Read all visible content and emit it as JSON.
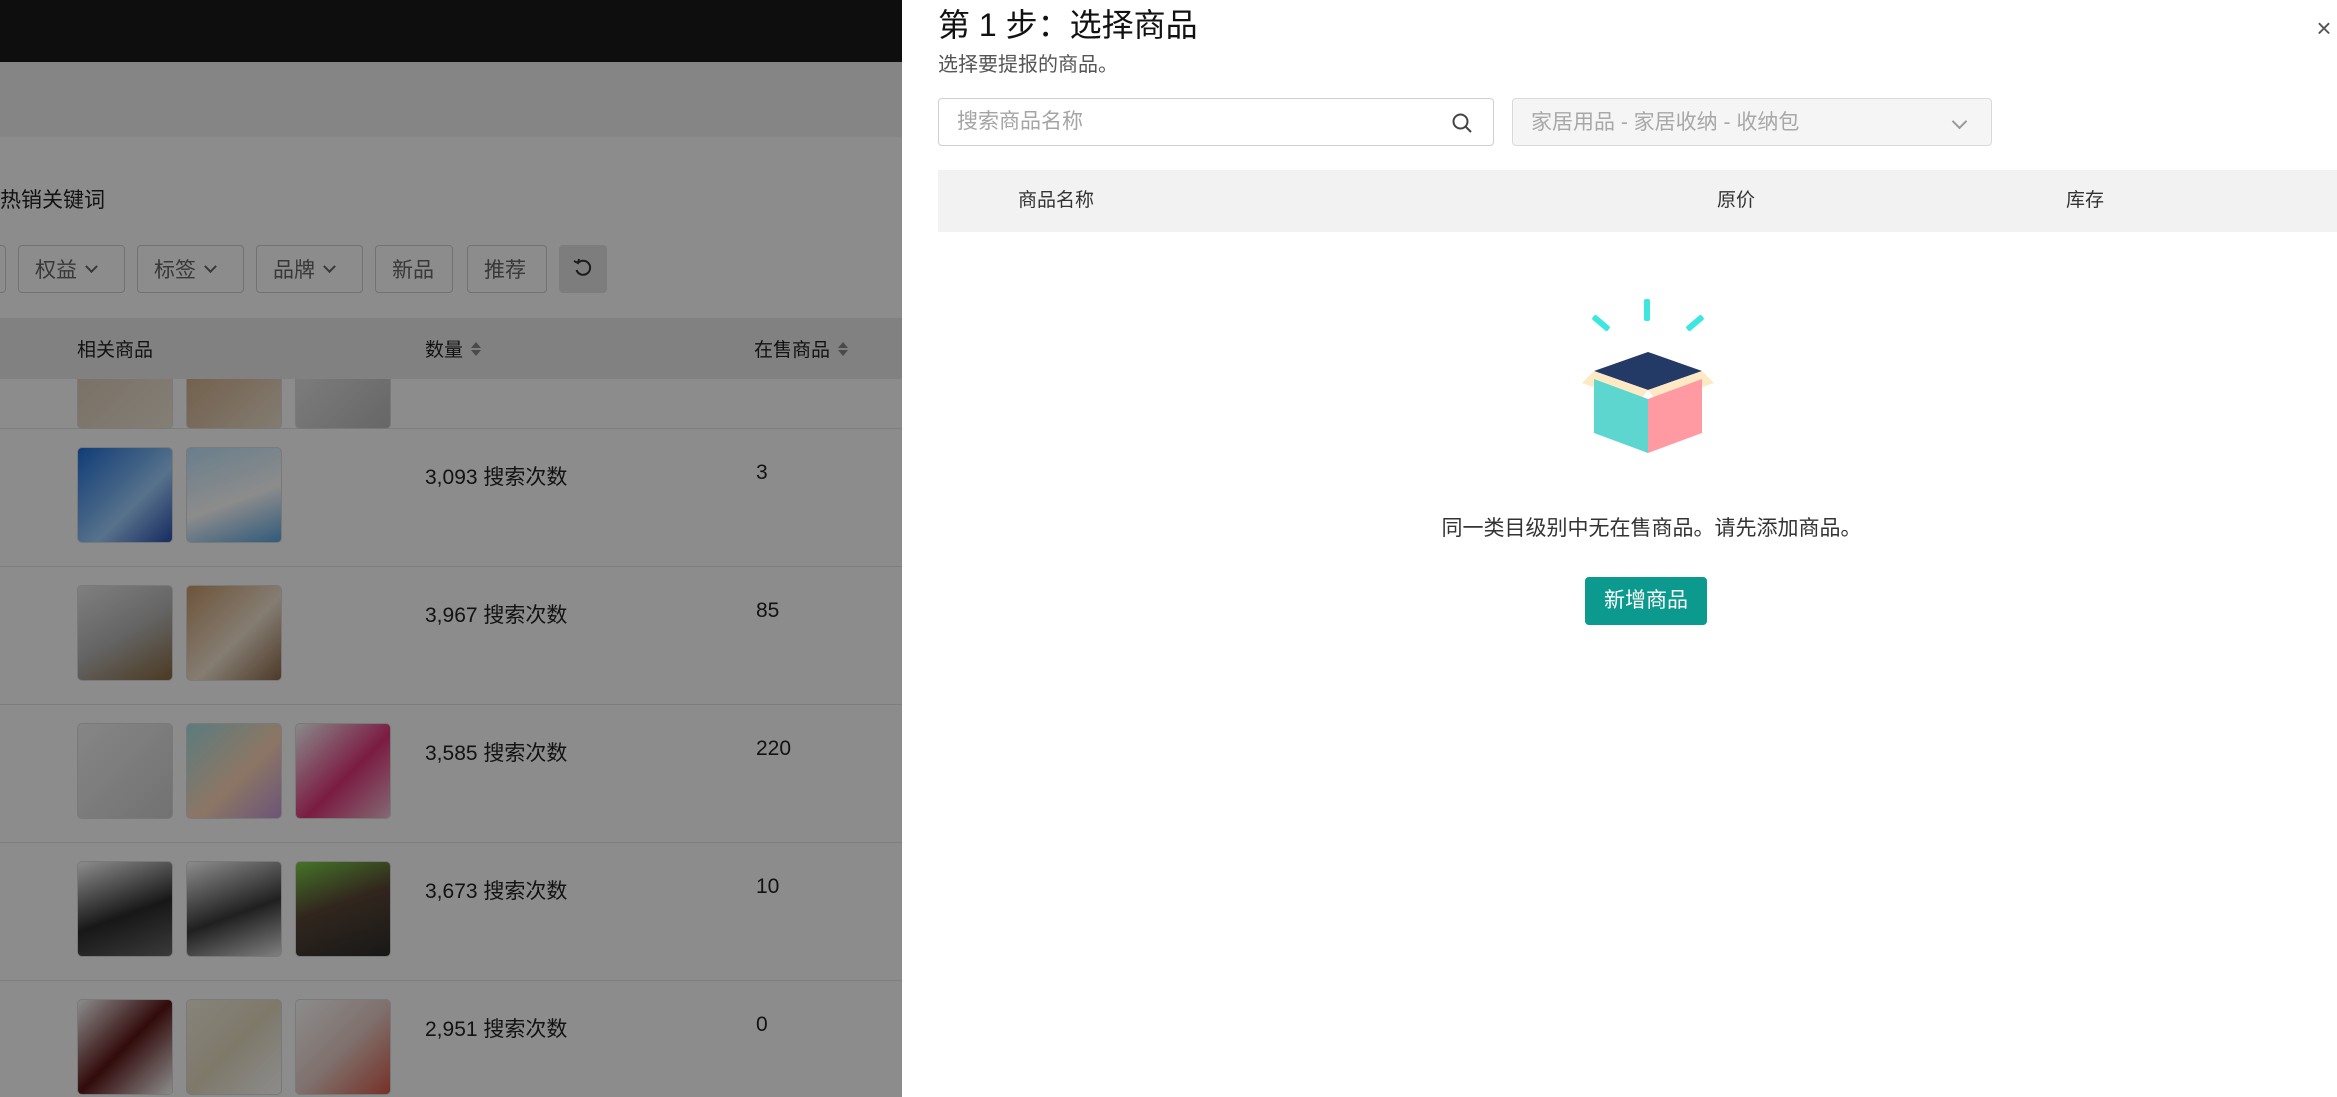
{
  "background": {
    "section_title": "热销关键词",
    "filters": [
      {
        "label": "权益"
      },
      {
        "label": "标签"
      },
      {
        "label": "品牌"
      },
      {
        "label": "新品"
      },
      {
        "label": "推荐"
      }
    ],
    "table": {
      "columns": {
        "products": "相关商品",
        "count": "数量",
        "onsale": "在售商品"
      },
      "rows": [
        {
          "count": "3,093 搜索次数",
          "onsale": "3"
        },
        {
          "count": "3,967 搜索次数",
          "onsale": "85"
        },
        {
          "count": "3,585 搜索次数",
          "onsale": "220"
        },
        {
          "count": "3,673 搜索次数",
          "onsale": "10"
        },
        {
          "count": "2,951 搜索次数",
          "onsale": "0"
        }
      ]
    }
  },
  "drawer": {
    "title": "第 1 步：选择商品",
    "subtitle": "选择要提报的商品。",
    "close_label": "×",
    "search": {
      "placeholder": "搜索商品名称",
      "value": ""
    },
    "category": {
      "value": "家居用品 - 家居收纳 - 收纳包"
    },
    "list_columns": {
      "name": "商品名称",
      "price": "原价",
      "stock": "库存"
    },
    "empty_text": "同一类目级别中无在售商品。请先添加商品。",
    "add_button": "新增商品"
  },
  "colors": {
    "accent": "#0d9a8e",
    "overlay": "rgba(0,0,0,0.45)",
    "box_top": "#243a66",
    "box_left": "#5dd6cf",
    "box_right": "#ff9aa2",
    "box_flap": "#fde9c4",
    "sparkles": "#3ee6e0"
  }
}
